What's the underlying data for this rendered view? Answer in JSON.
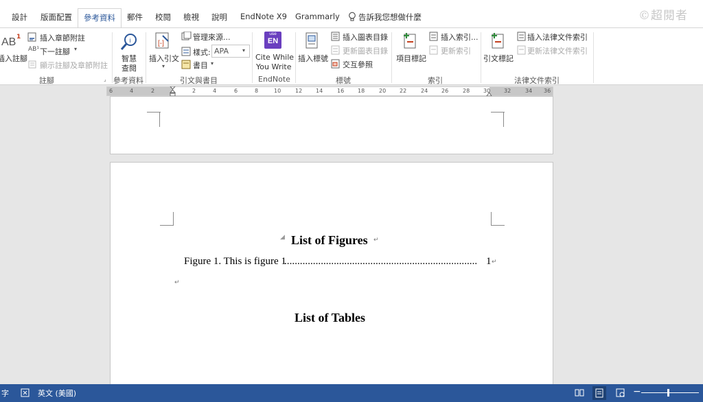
{
  "tabs": {
    "design": "設計",
    "layout": "版面配置",
    "references": "參考資料",
    "mailings": "郵件",
    "review": "校閱",
    "view": "檢視",
    "help": "說明",
    "endnote": "EndNote X9",
    "grammarly": "Grammarly",
    "tell_me": "告訴我您想做什麼"
  },
  "watermark": "©超閱者",
  "ribbon": {
    "footnotes": {
      "insert_footnote": "插入註腳",
      "insert_endnote": "插入章節附註",
      "next_footnote": "下一註腳",
      "show_notes": "顯示註腳及章節附註",
      "group": "註腳"
    },
    "research": {
      "smart_lookup_1": "智慧",
      "smart_lookup_2": "查閱",
      "group": "參考資料"
    },
    "citations": {
      "insert_citation": "插入引文",
      "manage_sources": "管理來源...",
      "style_label": "樣式:",
      "style_value": "APA",
      "bibliography": "書目",
      "group": "引文與書目"
    },
    "endnote_group": {
      "icon_top": "use",
      "icon_main": "EN",
      "cite_1": "Cite While",
      "cite_2": "You Write",
      "group": "EndNote"
    },
    "captions": {
      "insert_caption": "插入標號",
      "insert_tof": "插入圖表目錄",
      "update_table": "更新圖表目錄",
      "cross_reference": "交互參照",
      "group": "標號"
    },
    "index": {
      "mark_entry": "項目標記",
      "insert_index": "插入索引...",
      "update_index": "更新索引",
      "group": "索引"
    },
    "toa": {
      "mark_citation": "引文標記",
      "insert_toa": "插入法律文件索引",
      "update_toa": "更新法律文件索引",
      "group": "法律文件索引"
    }
  },
  "ruler": {
    "left_numbers": [
      "6",
      "4",
      "2"
    ],
    "numbers": [
      "2",
      "4",
      "6",
      "8",
      "10",
      "12",
      "14",
      "16",
      "18",
      "20",
      "22",
      "24",
      "26",
      "28",
      "30",
      "32",
      "34",
      "36"
    ]
  },
  "document": {
    "heading_figures": "List of Figures",
    "figure_entry": "Figure 1. This is figure 1",
    "figure_dots": "..........................................................................",
    "figure_page": "1",
    "heading_tables": "List of Tables"
  },
  "status": {
    "words": "字",
    "language": "英文 (美國)"
  },
  "colors": {
    "accent": "#2b579a",
    "endnote_purple": "#6a3fbf"
  }
}
